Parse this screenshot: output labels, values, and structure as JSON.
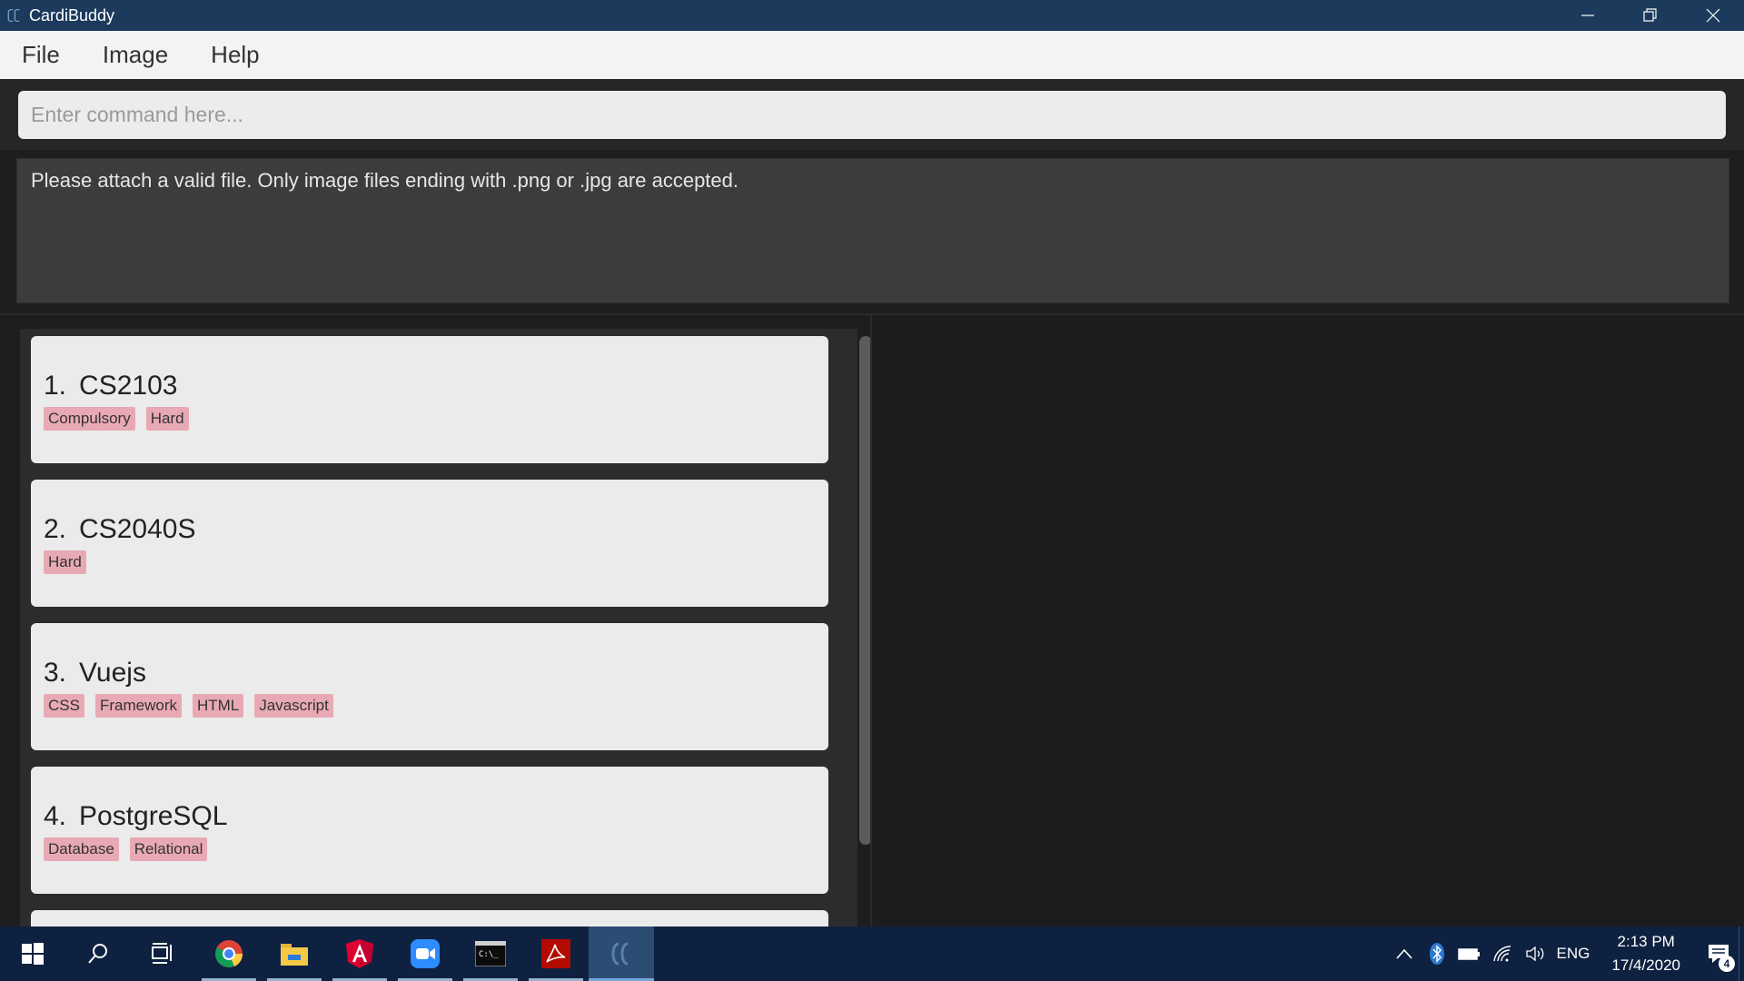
{
  "window": {
    "title": "CardiBuddy"
  },
  "menu": {
    "items": [
      {
        "label": "File"
      },
      {
        "label": "Image"
      },
      {
        "label": "Help"
      }
    ]
  },
  "command": {
    "placeholder": "Enter command here...",
    "value": ""
  },
  "result": {
    "message": "Please attach a valid file. Only image files ending with .png or .jpg are accepted."
  },
  "decks": [
    {
      "index": "1.",
      "name": "CS2103",
      "tags": [
        "Compulsory",
        "Hard"
      ]
    },
    {
      "index": "2.",
      "name": "CS2040S",
      "tags": [
        "Hard"
      ]
    },
    {
      "index": "3.",
      "name": "Vuejs",
      "tags": [
        "CSS",
        "Framework",
        "HTML",
        "Javascript"
      ]
    },
    {
      "index": "4.",
      "name": "PostgreSQL",
      "tags": [
        "Database",
        "Relational"
      ]
    }
  ],
  "colors": {
    "titlebar": "#1b3a5c",
    "tag": "#e8a9b5",
    "card": "#ebebeb",
    "taskbar": "#0e2140"
  },
  "taskbar": {
    "apps": [
      "start-icon",
      "search-icon",
      "task-view-icon",
      "chrome-icon",
      "file-explorer-icon",
      "angular-icon",
      "zoom-icon",
      "terminal-icon",
      "acrobat-icon",
      "cardibuddy-icon"
    ],
    "language": "ENG",
    "time": "2:13 PM",
    "date": "17/4/2020",
    "notification_count": "4"
  }
}
